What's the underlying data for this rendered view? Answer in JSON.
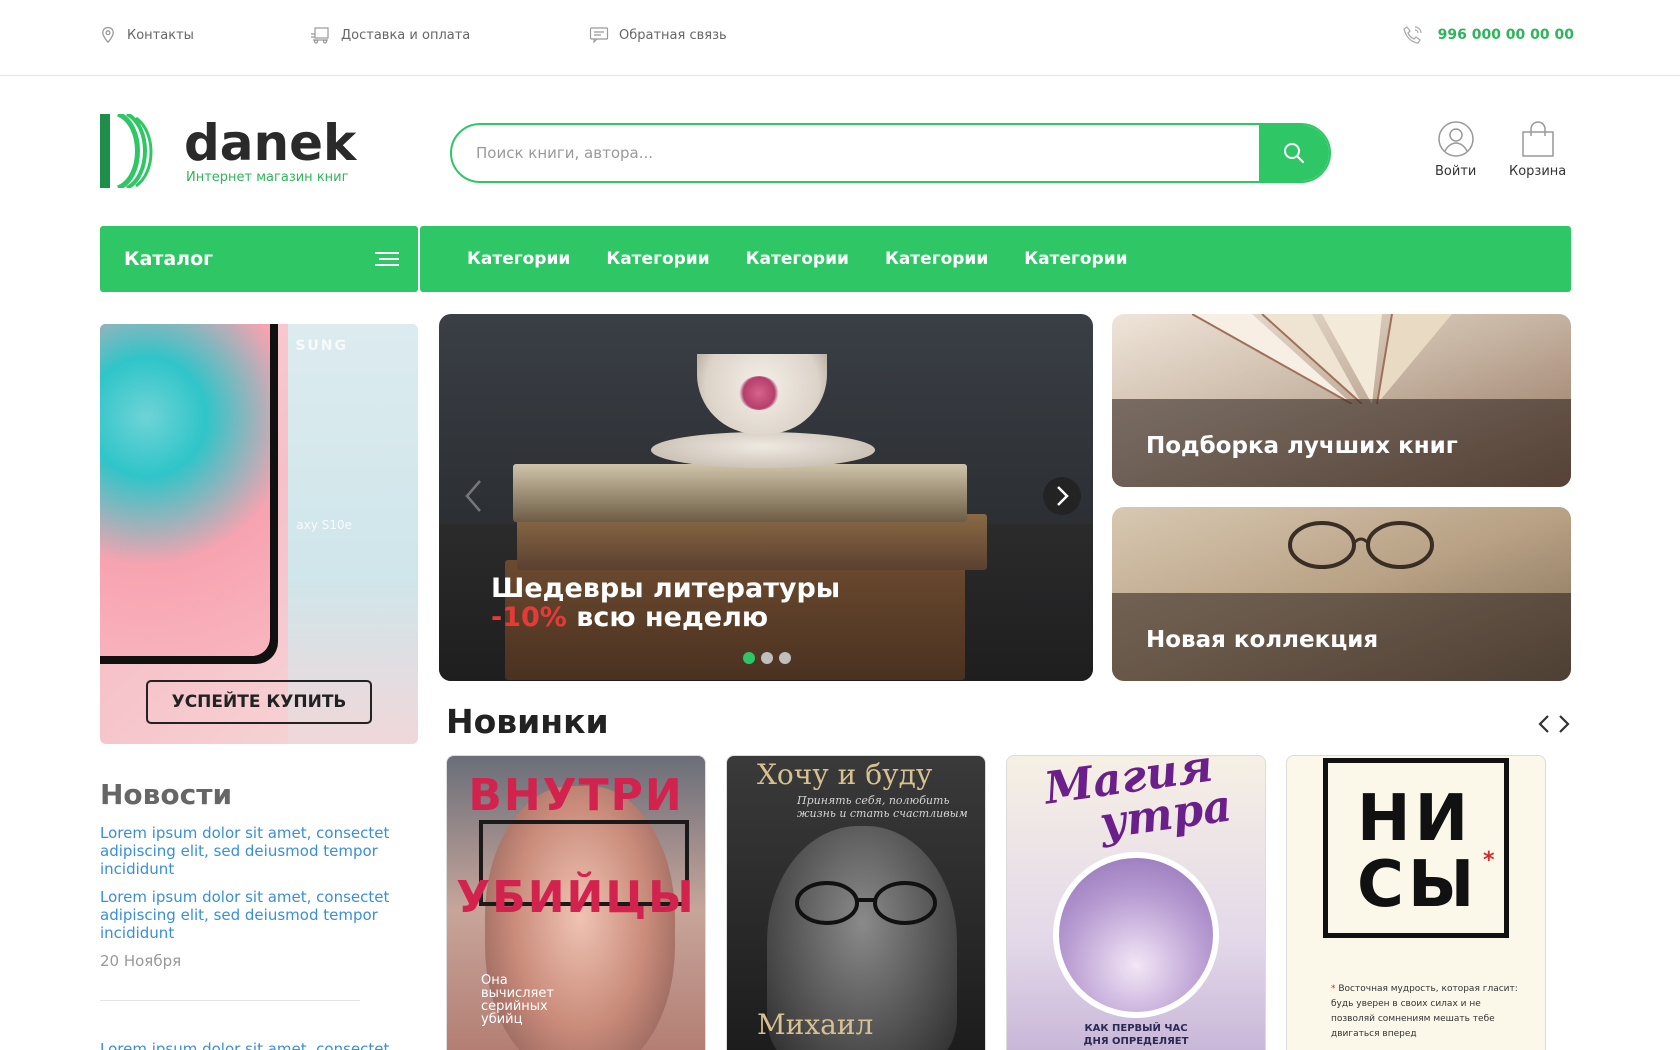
{
  "topbar": {
    "contacts": "Контакты",
    "delivery": "Доставка и оплата",
    "feedback": "Обратная связь",
    "phone": "996 000 00 00 00",
    "icons": [
      "location-pin-icon",
      "delivery-icon",
      "chat-icon",
      "phone-icon"
    ]
  },
  "logo": {
    "name": "danek",
    "tagline": "Интернет магазин книг"
  },
  "search": {
    "placeholder": "Поиск книги, автора..."
  },
  "header_actions": {
    "login": "Войти",
    "cart": "Корзина"
  },
  "nav": {
    "catalog": "Каталог",
    "links": [
      "Категории",
      "Категории",
      "Категории",
      "Категории",
      "Категории"
    ]
  },
  "promo": {
    "brand": "SUNG",
    "model": "axy S10e",
    "button": "УСПЕЙТЕ КУПИТЬ"
  },
  "slider": {
    "title_line1": "Шедевры литературы",
    "discount": "-10%",
    "title_line2_rest": " всю неделю",
    "slides_total": 3,
    "active_slide": 1
  },
  "cards": [
    {
      "title": "Подборка лучших книг"
    },
    {
      "title": "Новая коллекция"
    }
  ],
  "news": {
    "title": "Новости",
    "items": [
      "Lorem ipsum dolor sit amet, consectet adipiscing elit, sed deiusmod tempor incididunt",
      "Lorem ipsum dolor sit amet, consectet adipiscing elit, sed deiusmod tempor incididunt"
    ],
    "date": "20 Ноября",
    "next_item": "Lorem ipsum dolor sit amet, consectet"
  },
  "new_releases": {
    "title": "Новинки",
    "books": [
      {
        "title_top": "ВНУТРИ",
        "title_bottom": "УБИЙЦЫ",
        "subtitle": "Она вычисляет серийных убийц"
      },
      {
        "title": "Хочу и буду",
        "subtitle": "Принять себя, полюбить жизнь и стать счастливым",
        "author": "Михаил"
      },
      {
        "title_line1": "Магия",
        "title_line2": "утра",
        "subtitle": "КАК ПЕРВЫЙ ЧАС ДНЯ ОПРЕДЕЛЯЕТ ВАШ УСПЕХ"
      },
      {
        "title": "НИ СЫ",
        "star": "*",
        "subtitle_star": "*",
        "subtitle": "Восточная мудрость, которая гласит: будь уверен в своих силах и не позволяй сомнениям мешать тебе двигаться вперед"
      }
    ]
  },
  "colors": {
    "accent": "#2fc766",
    "phone": "#2fb45c",
    "link": "#3a8fd4",
    "discount": "#e63a3a"
  }
}
